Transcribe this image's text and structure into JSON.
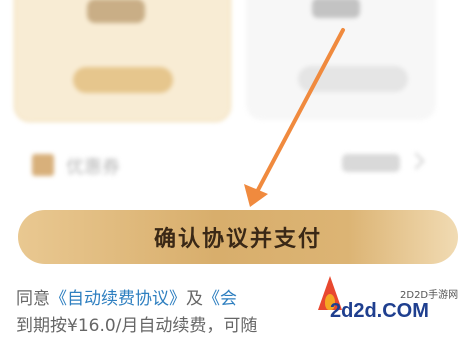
{
  "coupon": {
    "label": "优惠券"
  },
  "pay_button": {
    "label": "确认协议并支付"
  },
  "agreement": {
    "prefix": "同意",
    "link1": "《自动续费协议》",
    "middle": "及",
    "link2_partial": "《会",
    "line2": "到期按¥16.0/月自动续费，可随"
  },
  "watermark": {
    "small": "2D2D手游网",
    "big": "2d2d.COM"
  },
  "colors": {
    "accent_gold": "#d8ae6c",
    "button_text": "#3a2816",
    "link_blue": "#2e7fc0",
    "arrow_orange": "#f08a3e"
  },
  "icons": [
    "coupon-icon",
    "chevron-right-icon",
    "arrow-annotation-icon",
    "flame-logo-icon"
  ]
}
